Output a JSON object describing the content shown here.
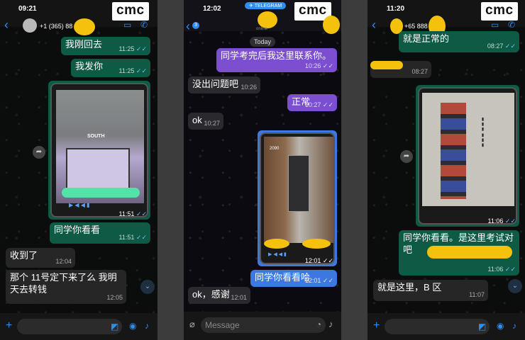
{
  "brand": "cmc",
  "panel1": {
    "status_time": "09:21",
    "contact": "+1 (365) 88",
    "messages": [
      {
        "text": "我刚回去",
        "time": "11:25"
      },
      {
        "text": "我发你",
        "time": "11:25"
      },
      {
        "image_time": "11:51",
        "image_sign": "SOUTH"
      },
      {
        "text": "同学你看看",
        "time": "11:51"
      },
      {
        "text": "收到了",
        "time": "12:04"
      },
      {
        "text": "那个 11号定下来了么 我明天去转钱",
        "time": "12:05"
      }
    ]
  },
  "panel2": {
    "status_time": "12:02",
    "badge": "TELEGRAM",
    "back_count": "3",
    "subtitle": "online",
    "messages": [
      {
        "text": "同学考完后我这里联系你。",
        "time": "10:26"
      },
      {
        "text": "没出问题吧",
        "time": "10:26"
      },
      {
        "text": "正常",
        "time": "10:27"
      },
      {
        "text": "ok",
        "time": "10:27"
      },
      {
        "day": "Today"
      },
      {
        "image_time": "12:01",
        "image_room": "2090"
      },
      {
        "text": "同学你看看哈",
        "time": "12:01"
      },
      {
        "text": "ok，感谢",
        "time": "12:01"
      }
    ],
    "placeholder": "Message"
  },
  "panel3": {
    "status_time": "11:20",
    "contact": "+65 888",
    "messages": [
      {
        "text": "就是正常的",
        "time": "08:27"
      },
      {
        "text": "",
        "time": "08:27"
      },
      {
        "image_time": "11:06"
      },
      {
        "text": "同学你看看。是这里考试对吧",
        "time": "11:06"
      },
      {
        "text": "就是这里，B 区",
        "time": "11:07"
      }
    ]
  },
  "colors": {
    "outgoing_whatsapp": "#0e5a45",
    "outgoing_telegram": "#7b4fd0",
    "telegram_blue": "#3d78e0",
    "accent": "#2f8cf0",
    "censor_yellow": "#f4c20d",
    "censor_green": "#53e3a9"
  }
}
